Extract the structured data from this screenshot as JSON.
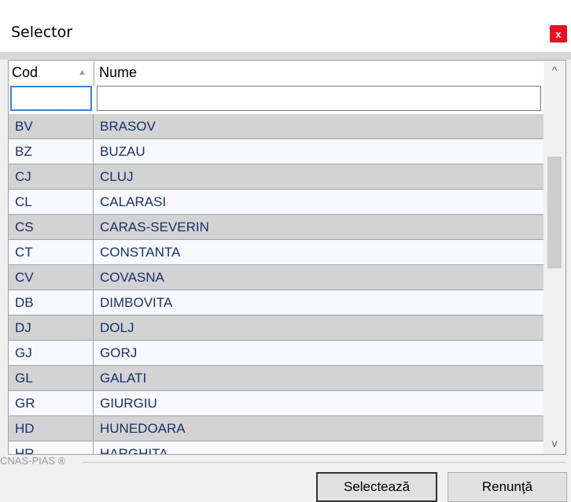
{
  "window": {
    "title": "Selector",
    "close_label": "x"
  },
  "grid": {
    "columns": [
      {
        "label": "Cod"
      },
      {
        "label": "Nume"
      }
    ],
    "sort_indicator": "▲",
    "filters": {
      "cod": "",
      "nume": ""
    },
    "rows": [
      {
        "cod": "BV",
        "nume": "BRASOV"
      },
      {
        "cod": "BZ",
        "nume": "BUZAU"
      },
      {
        "cod": "CJ",
        "nume": "CLUJ"
      },
      {
        "cod": "CL",
        "nume": "CALARASI"
      },
      {
        "cod": "CS",
        "nume": "CARAS-SEVERIN"
      },
      {
        "cod": "CT",
        "nume": "CONSTANTA"
      },
      {
        "cod": "CV",
        "nume": "COVASNA"
      },
      {
        "cod": "DB",
        "nume": "DIMBOVITA"
      },
      {
        "cod": "DJ",
        "nume": "DOLJ"
      },
      {
        "cod": "GJ",
        "nume": "GORJ"
      },
      {
        "cod": "GL",
        "nume": "GALATI"
      },
      {
        "cod": "GR",
        "nume": "GIURGIU"
      },
      {
        "cod": "HD",
        "nume": "HUNEDOARA"
      },
      {
        "cod": "HR",
        "nume": "HARGHITA"
      }
    ],
    "scroll": {
      "up": "^",
      "down": "v"
    }
  },
  "footer": {
    "group_label": "CNAS-PIAS ®",
    "select_label": "Selectează",
    "cancel_label": "Renunţă"
  },
  "colors": {
    "alt_row": "#d3d3d3",
    "close": "#e81123",
    "row_text": "#18306a"
  }
}
